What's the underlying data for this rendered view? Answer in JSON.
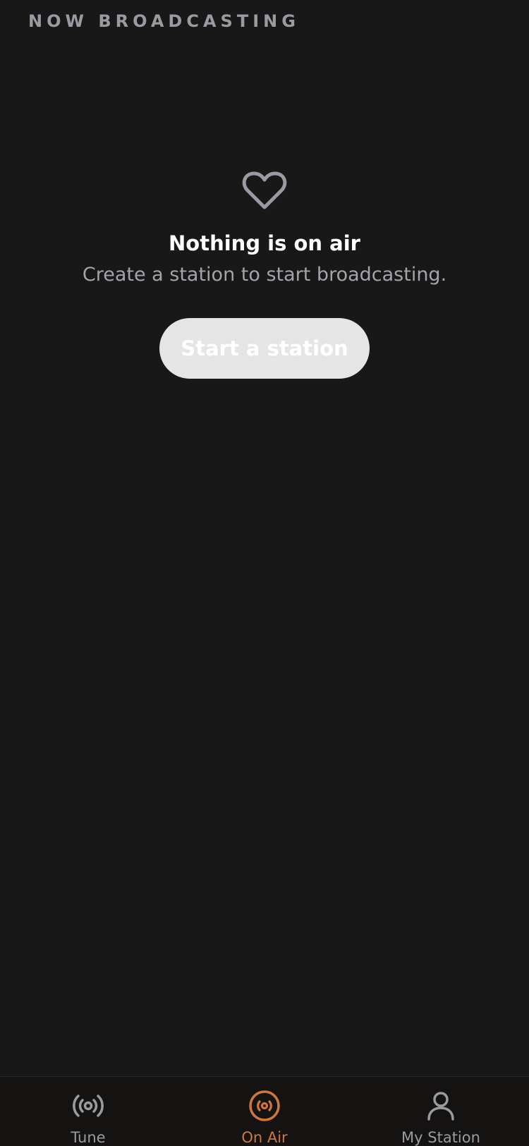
{
  "header": {
    "title": "NOW BROADCASTING"
  },
  "empty_state": {
    "icon": "heart-outline-icon",
    "title": "Nothing is on air",
    "subtitle": "Create a station to start broadcasting.",
    "button_label": "Start a station"
  },
  "tab_bar": {
    "active_color": "#d1773a",
    "inactive_color": "#9a9a9f",
    "tabs": [
      {
        "label": "Tune",
        "icon": "broadcast-icon",
        "active": false
      },
      {
        "label": "On Air",
        "icon": "on-air-disc-icon",
        "active": true
      },
      {
        "label": "My Station",
        "icon": "user-icon",
        "active": false
      }
    ]
  }
}
